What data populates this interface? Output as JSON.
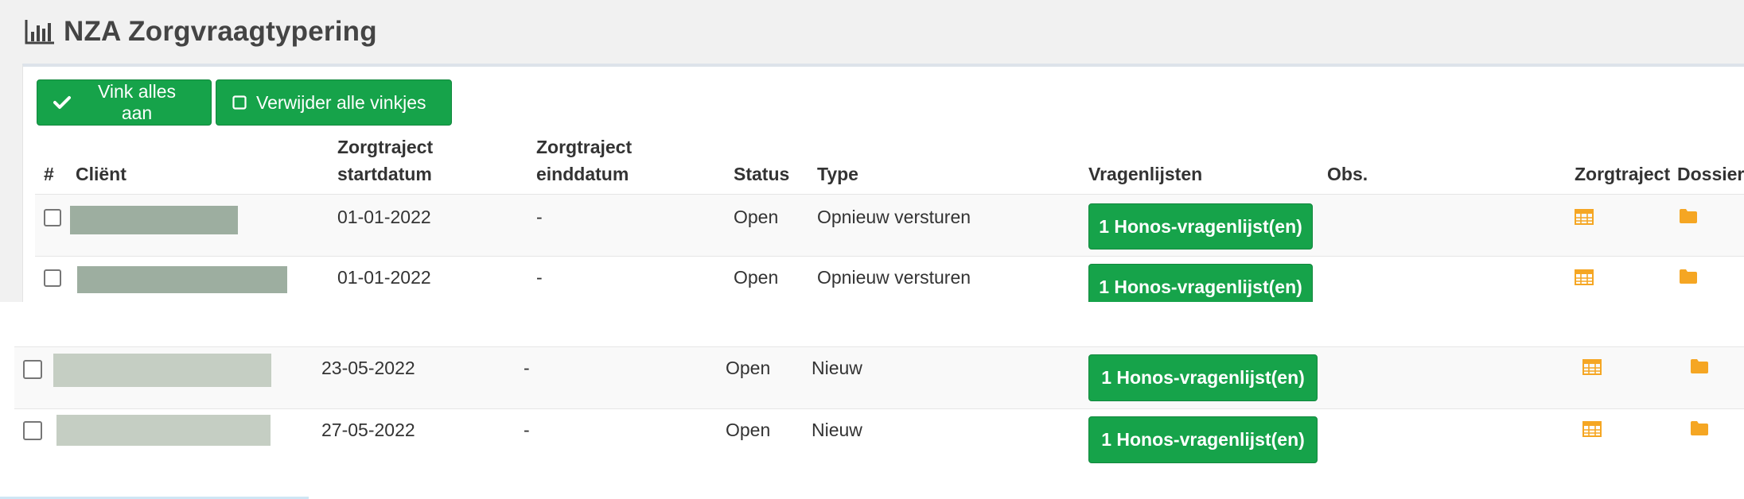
{
  "header": {
    "title": "NZA Zorgvraagtypering",
    "icon": "bar-chart-icon"
  },
  "toolbar": {
    "check_all_label": "Vink alles aan",
    "check_all_icon": "checkmark-icon",
    "uncheck_all_label": "Verwijder alle vinkjes",
    "uncheck_all_icon": "empty-square-icon"
  },
  "table": {
    "columns": {
      "index": "#",
      "client": "Cliënt",
      "start_line1": "Zorgtraject",
      "start_line2": "startdatum",
      "end_line1": "Zorgtraject",
      "end_line2": "einddatum",
      "status": "Status",
      "type": "Type",
      "questionnaires": "Vragenlijsten",
      "obs": "Obs.",
      "care_path": "Zorgtraject",
      "dossier": "Dossier"
    },
    "rows": [
      {
        "start": "01-01-2022",
        "end": "-",
        "status": "Open",
        "type": "Opnieuw versturen",
        "questionnaires": "1 Honos-vragenlijst(en)",
        "obs": "",
        "client_redacted": true
      },
      {
        "start": "01-01-2022",
        "end": "-",
        "status": "Open",
        "type": "Opnieuw versturen",
        "questionnaires": "1 Honos-vragenlijst(en)",
        "obs": "",
        "client_redacted": true
      },
      {
        "start": "23-05-2022",
        "end": "-",
        "status": "Open",
        "type": "Nieuw",
        "questionnaires": "1 Honos-vragenlijst(en)",
        "obs": "",
        "client_redacted": true
      },
      {
        "start": "27-05-2022",
        "end": "-",
        "status": "Open",
        "type": "Nieuw",
        "questionnaires": "1 Honos-vragenlijst(en)",
        "obs": "",
        "client_redacted": true
      }
    ]
  },
  "colors": {
    "accent_green": "#16a34a",
    "icon_orange": "#f5a623",
    "redaction_1": "#9daea0",
    "redaction_2": "#c5cec3"
  },
  "icons": {
    "care_path": "table-grid-icon",
    "dossier": "folder-icon"
  }
}
